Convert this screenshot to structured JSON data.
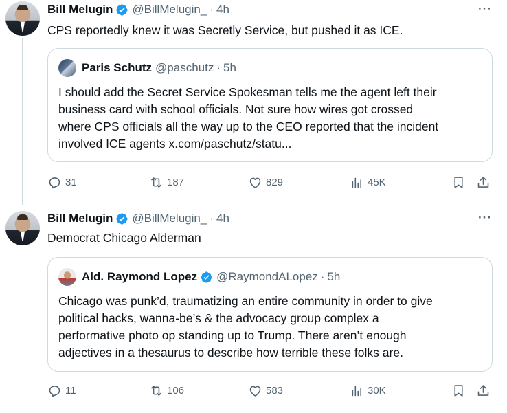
{
  "tweets": [
    {
      "author": {
        "name": "Bill Melugin",
        "handle": "@BillMelugin_",
        "time": "4h",
        "verified": true
      },
      "text": "CPS reportedly knew it was Secretly Service, but pushed it as ICE.",
      "more_label": "···",
      "quote": {
        "author": {
          "name": "Paris Schutz",
          "handle": "@paschutz",
          "time": "5h",
          "verified": false
        },
        "lines": [
          "I should add the Secret Service Spokesman tells me the agent left their",
          "business card with school officials. Not sure how wires got crossed",
          "where CPS officials all the way up to the CEO reported that the incident",
          "involved ICE agents x.com/paschutz/statu..."
        ]
      },
      "stats": {
        "replies": "31",
        "retweets": "187",
        "likes": "829",
        "views": "45K"
      }
    },
    {
      "author": {
        "name": "Bill Melugin",
        "handle": "@BillMelugin_",
        "time": "4h",
        "verified": true
      },
      "text": "Democrat Chicago Alderman",
      "more_label": "···",
      "quote": {
        "author": {
          "name": "Ald. Raymond Lopez",
          "handle": "@RaymondALopez",
          "time": "5h",
          "verified": true
        },
        "lines": [
          "Chicago was punk’d, traumatizing an entire community in order to give",
          "political hacks, wanna-be’s & the advocacy group complex a",
          "performative photo op standing up to Trump. There aren’t enough",
          "adjectives in a thesaurus to describe how terrible these folks are."
        ]
      },
      "stats": {
        "replies": "11",
        "retweets": "106",
        "likes": "583",
        "views": "30K"
      }
    }
  ],
  "separator": "·",
  "colors": {
    "verified_blue": "#1d9bf0",
    "secondary_text": "#536471",
    "border": "#cfd9de"
  },
  "icons": [
    "verified-badge-icon",
    "more-icon",
    "reply-icon",
    "retweet-icon",
    "like-icon",
    "views-icon",
    "bookmark-icon",
    "share-icon"
  ]
}
